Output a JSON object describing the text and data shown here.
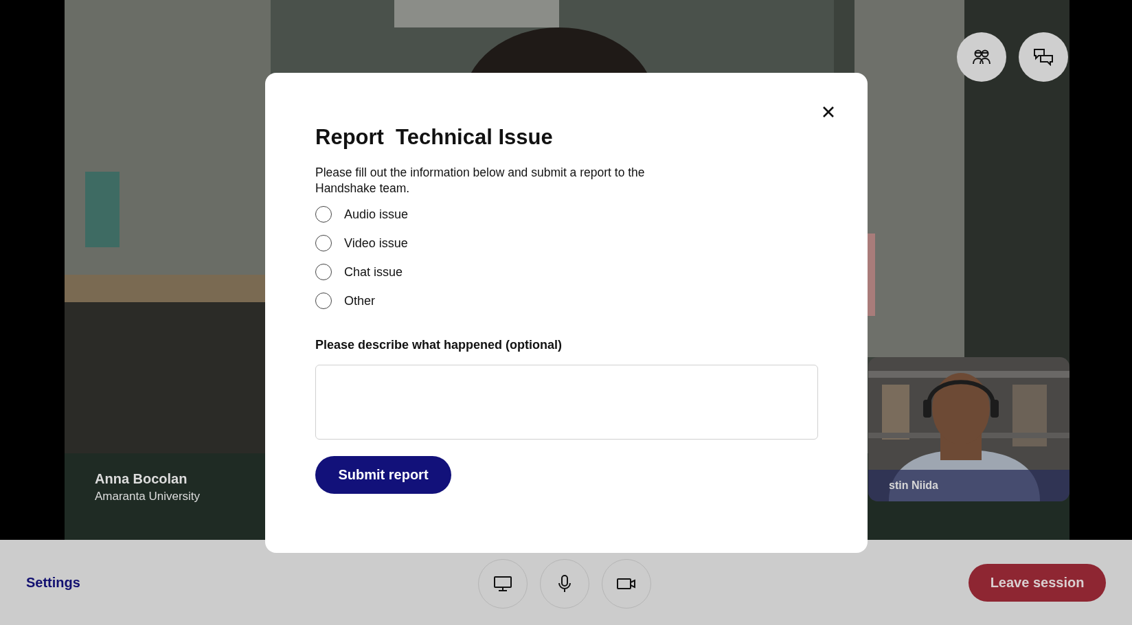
{
  "main_video": {
    "kind": "picture",
    "name": "Anna Bocolan",
    "subtitle": "Amaranta University"
  },
  "thumbnail": {
    "kind": "picture",
    "name": "stin Niida"
  },
  "dialog": {
    "title": "Report  Technical Issue",
    "description": "Please fill out the information below and submit a report to the Handshake team.",
    "options": [
      {
        "label": "Audio issue",
        "selected": false
      },
      {
        "label": "Video issue",
        "selected": false
      },
      {
        "label": "Chat issue",
        "selected": false
      },
      {
        "label": "Other",
        "selected": false
      }
    ],
    "field_label": "Please describe what happened (optional)",
    "submit": "Submit report"
  },
  "bottom_bar": {
    "settings": "Settings",
    "leave": "Leave session"
  }
}
